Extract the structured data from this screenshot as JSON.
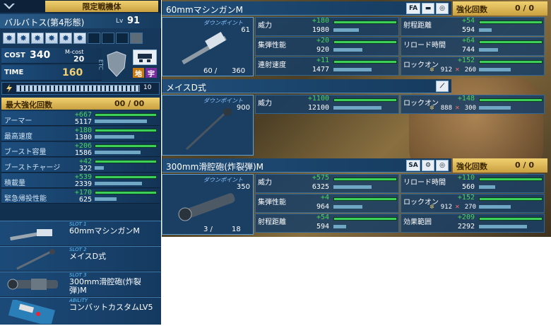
{
  "unit": {
    "category": "限定戦機体",
    "name": "バルバトス(第4形態)",
    "level_label": "Lv",
    "level": "91",
    "cost_label": "COST",
    "cost": "340",
    "mcost_label": "M-cost",
    "mcost": "20",
    "etc_label": "ETC",
    "time_label": "TIME",
    "time": "160",
    "terrain": [
      "地",
      "宇"
    ],
    "gauge_value": "10",
    "enhance_label": "最大強化回数",
    "enhance_value": "00 / 00"
  },
  "stats": [
    {
      "label": "アーマー",
      "plus": "+667",
      "value": "5117",
      "bonus_frac": 0.98,
      "base_frac": 0.82
    },
    {
      "label": "最高速度",
      "plus": "+180",
      "value": "1380",
      "bonus_frac": 0.98,
      "base_frac": 0.62
    },
    {
      "label": "ブースト容量",
      "plus": "+206",
      "value": "1586",
      "bonus_frac": 0.98,
      "base_frac": 0.72
    },
    {
      "label": "ブーストチャージ",
      "plus": "+42",
      "value": "322",
      "bonus_frac": 0.98,
      "base_frac": 0.14
    },
    {
      "label": "積載量",
      "plus": "+539",
      "value": "2339",
      "bonus_frac": 0.98,
      "base_frac": 0.74
    },
    {
      "label": "緊急帰投性能",
      "plus": "+170",
      "value": "625",
      "bonus_frac": 0.98,
      "base_frac": 0.34
    }
  ],
  "slots": [
    {
      "tag": "SLOT 1",
      "name": "60mmマシンガンM"
    },
    {
      "tag": "SLOT 2",
      "name": "メイスD式"
    },
    {
      "tag": "SLOT 3",
      "name": "300mm滑腔砲(炸裂弾)M"
    },
    {
      "tag": "ABILITY",
      "name": "コンバットカスタムLV5"
    }
  ],
  "weapons": [
    {
      "name": "60mmマシンガンM",
      "badges": [
        "FA"
      ],
      "enhance_label": "強化回数",
      "enhance_value": "0 / 0",
      "down_label": "ダウンポイント",
      "down_value": "61",
      "ammo": "60 /",
      "ammo_max": "360",
      "stats": [
        {
          "label": "威力",
          "plus": "+180",
          "value": "1980",
          "frac": 0.4
        },
        {
          "label": "射程距離",
          "plus": "+54",
          "value": "594",
          "frac": 0.2
        },
        {
          "label": "集弾性能",
          "plus": "+20",
          "value": "920",
          "frac": 0.45
        },
        {
          "label": "リロード時間",
          "plus": "+64",
          "value": "744",
          "frac": 0.3
        },
        {
          "label": "連射速度",
          "plus": "+11",
          "value": "1477",
          "frac": 0.6
        },
        {
          "label": "ロックオン",
          "plus": "+152",
          "value_a": "912",
          "value_b": "260",
          "frac": 0.5
        }
      ]
    },
    {
      "name": "メイスD式",
      "badges": [],
      "down_label": "ダウンポイント",
      "down_value": "900",
      "stats": [
        {
          "label": "威力",
          "plus": "+1100",
          "value": "12100",
          "frac": 0.75
        },
        {
          "label": "ロックオン",
          "plus": "+148",
          "value_a": "888",
          "value_b": "300",
          "frac": 0.5
        }
      ]
    },
    {
      "name": "300mm滑腔砲(炸裂弾)M",
      "badges": [
        "SA"
      ],
      "enhance_label": "強化回数",
      "enhance_value": "0 / 0",
      "down_label": "ダウンポイント",
      "down_value": "350",
      "ammo": "3 /",
      "ammo_max": "18",
      "stats": [
        {
          "label": "威力",
          "plus": "+575",
          "value": "6325",
          "frac": 0.6
        },
        {
          "label": "リロード時間",
          "plus": "+110",
          "value": "560",
          "frac": 0.25
        },
        {
          "label": "集弾性能",
          "plus": "+4",
          "value": "964",
          "frac": 0.45
        },
        {
          "label": "ロックオン",
          "plus": "+152",
          "value_a": "912",
          "value_b": "270",
          "frac": 0.5
        },
        {
          "label": "射程距離",
          "plus": "+54",
          "value": "594",
          "frac": 0.2
        },
        {
          "label": "効果範囲",
          "plus": "+209",
          "value": "2292",
          "frac": 0.75
        }
      ]
    }
  ],
  "colors": {
    "accent_gold": "#f0d070",
    "plus_green": "#4bd45a",
    "panel_blue": "#1a3f63"
  }
}
